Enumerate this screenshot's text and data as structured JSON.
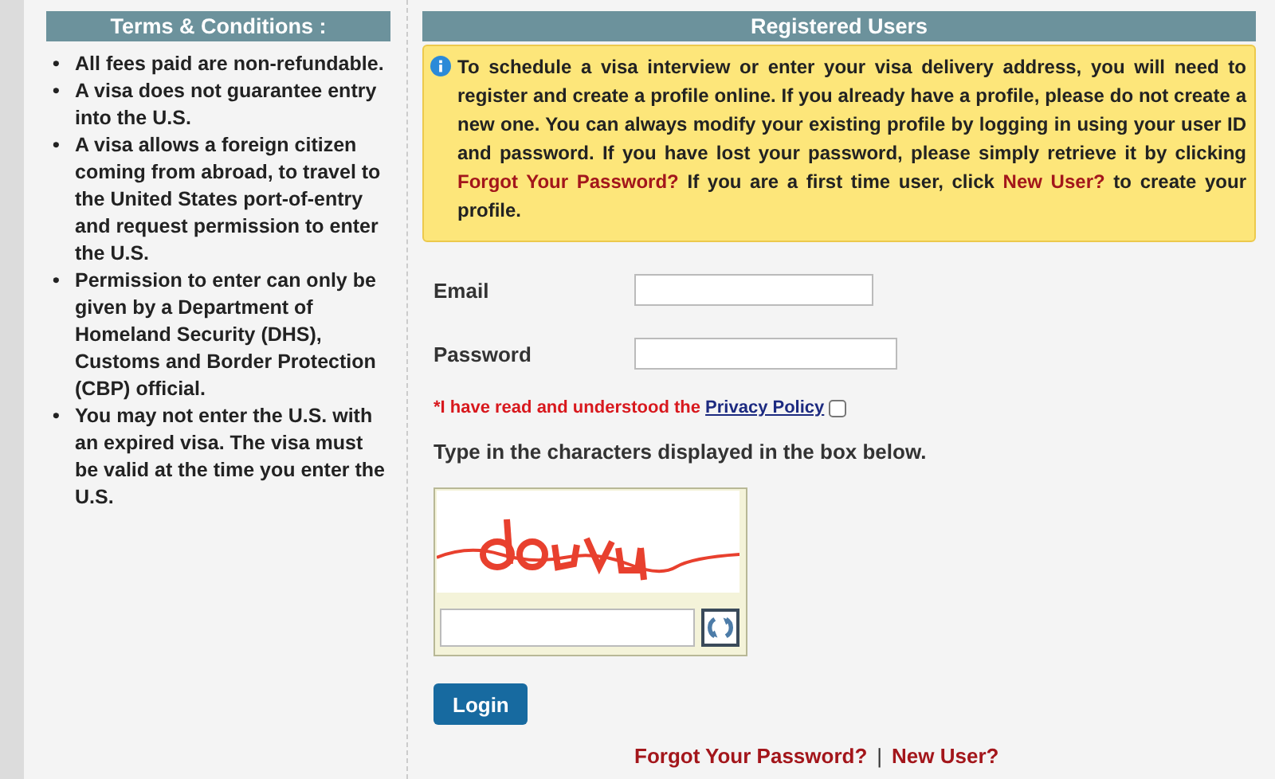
{
  "terms": {
    "title": "Terms & Conditions :",
    "bullet": "•",
    "items": [
      "All fees paid are non-refundable.",
      "A visa does not guarantee entry into the U.S.",
      "A visa allows a foreign citizen coming from abroad, to travel to the United States port-of-entry and request permission to enter the U.S.",
      "Permission to enter can only be given by a Department of Homeland Security (DHS), Customs and Border Protection (CBP) official.",
      "You may not enter the U.S. with an expired visa. The visa must be valid at the time you enter the U.S."
    ]
  },
  "login": {
    "title": "Registered Users",
    "info": [
      {
        "kind": "text",
        "text": "To schedule a visa interview or enter your visa delivery address, you will need to register and create a profile online. If you already have a profile, please do not create a new one. You can always modify your existing profile by logging in using your user ID and password. If you have lost your password, please simply retrieve it by clicking "
      },
      {
        "kind": "link",
        "text": "Forgot Your Password?"
      },
      {
        "kind": "text",
        "text": " If you are a first time user, click "
      },
      {
        "kind": "link",
        "text": "New User?"
      },
      {
        "kind": "text",
        "text": " to create your profile."
      }
    ],
    "fields": [
      {
        "label": "Email",
        "kind": "email"
      },
      {
        "label": "Password",
        "kind": "password"
      }
    ],
    "privacy": {
      "text": "*I have read and understood the ",
      "link": "Privacy Policy",
      "checked": false
    },
    "captcha_prompt": "Type in the characters displayed in the box below.",
    "login_button": "Login",
    "links": [
      "Forgot Your Password?",
      "New User?"
    ],
    "separator": "|"
  }
}
